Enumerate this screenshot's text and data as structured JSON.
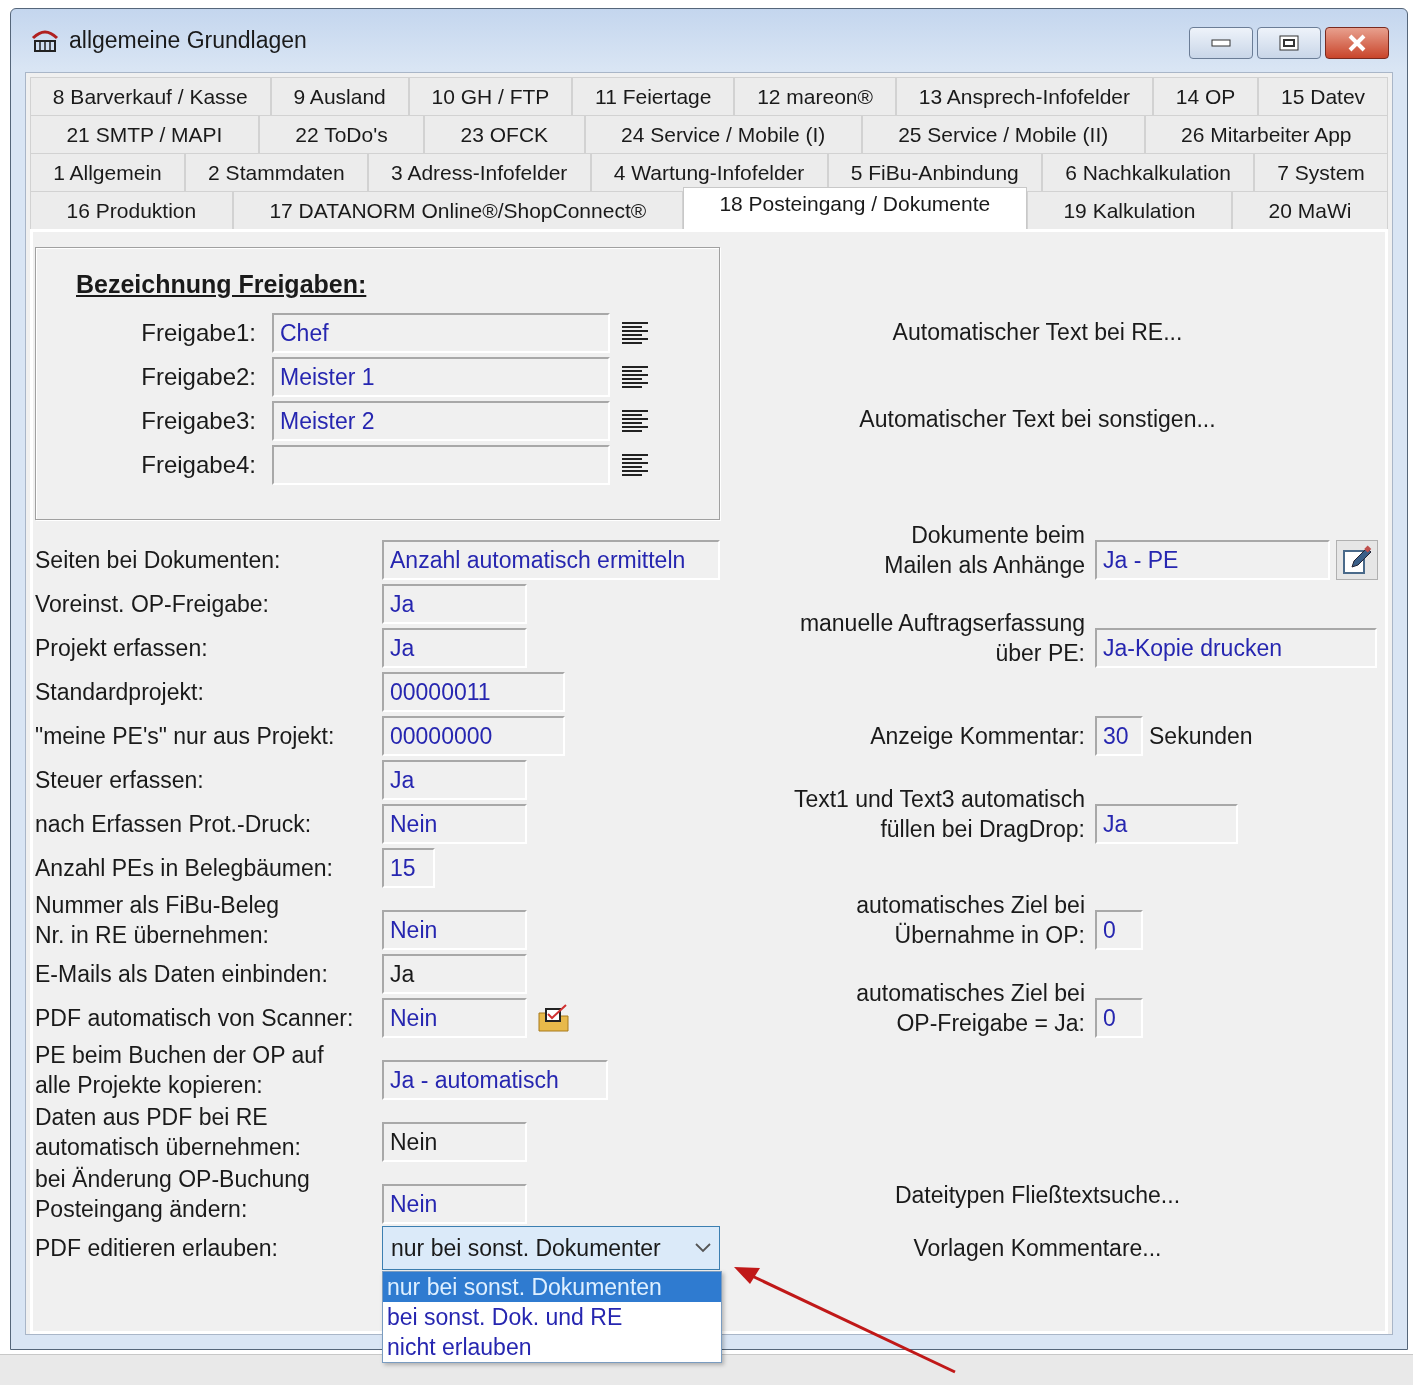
{
  "window": {
    "title": "allgemeine Grundlagen"
  },
  "tab_rows": [
    {
      "tabs": [
        {
          "label": "8 Barverkauf / Kasse",
          "selected": false
        },
        {
          "label": "9 Ausland",
          "selected": false
        },
        {
          "label": "10 GH / FTP",
          "selected": false
        },
        {
          "label": "11 Feiertage",
          "selected": false
        },
        {
          "label": "12 mareon®",
          "selected": false
        },
        {
          "label": "13 Ansprech-Infofelder",
          "selected": false
        },
        {
          "label": "14 OP",
          "selected": false
        },
        {
          "label": "15 Datev",
          "selected": false
        }
      ]
    },
    {
      "tabs": [
        {
          "label": "21 SMTP / MAPI",
          "selected": false
        },
        {
          "label": "22 ToDo's",
          "selected": false
        },
        {
          "label": "23 OFCK",
          "selected": false
        },
        {
          "label": "24 Service / Mobile (I)",
          "selected": false
        },
        {
          "label": "25 Service / Mobile (II)",
          "selected": false
        },
        {
          "label": "26 Mitarbeiter App",
          "selected": false
        }
      ]
    },
    {
      "tabs": [
        {
          "label": "1 Allgemein",
          "selected": false
        },
        {
          "label": "2 Stammdaten",
          "selected": false
        },
        {
          "label": "3 Adress-Infofelder",
          "selected": false
        },
        {
          "label": "4 Wartung-Infofelder",
          "selected": false
        },
        {
          "label": "5 FiBu-Anbindung",
          "selected": false
        },
        {
          "label": "6 Nachkalkulation",
          "selected": false
        },
        {
          "label": "7 System",
          "selected": false
        }
      ]
    },
    {
      "tabs": [
        {
          "label": "16 Produktion",
          "selected": false
        },
        {
          "label": "17 DATANORM Online®/ShopConnect®",
          "selected": false
        },
        {
          "label": "18 Posteingang / Dokumente",
          "selected": true
        },
        {
          "label": "19 Kalkulation",
          "selected": false
        },
        {
          "label": "20 MaWi",
          "selected": false
        }
      ]
    }
  ],
  "group": {
    "title": "Bezeichnung Freigaben:",
    "fields": [
      {
        "label": "Freigabe1:",
        "value": "Chef"
      },
      {
        "label": "Freigabe2:",
        "value": "Meister 1"
      },
      {
        "label": "Freigabe3:",
        "value": "Meister 2"
      },
      {
        "label": "Freigabe4:"
      }
    ]
  },
  "links": [
    "Automatischer Text bei RE...",
    "Automatischer Text bei sonstigen..."
  ],
  "rows": [
    {
      "kind": "field",
      "label": [
        "Seiten bei Dokumenten:"
      ],
      "value": "Anzahl automatisch ermitteln",
      "color": "#2626b0",
      "right": {
        "kind": "field-edit",
        "label": [
          "Dokumente beim",
          "Mailen als Anhänge"
        ],
        "value": "Ja - PE"
      }
    },
    {
      "kind": "field",
      "label": [
        "Voreinst. OP-Freigabe:"
      ],
      "value": "Ja",
      "color": "#2626b0"
    },
    {
      "kind": "field",
      "label": [
        "Projekt erfassen:"
      ],
      "value": "Ja",
      "color": "#2626b0",
      "right": {
        "kind": "field",
        "label": [
          "manuelle Auftragserfassung",
          "über PE:"
        ],
        "value": "Ja-Kopie drucken"
      }
    },
    {
      "kind": "field",
      "label": [
        "Standardprojekt:"
      ],
      "value": "00000011",
      "color": "#2626b0"
    },
    {
      "kind": "field",
      "label": [
        "\"meine PE's\" nur aus Projekt:"
      ],
      "value": "00000000",
      "color": "#2626b0",
      "right": {
        "kind": "field-unit",
        "label": [
          "Anzeige Kommentar:"
        ],
        "value": "30",
        "suffix": "Sekunden"
      }
    },
    {
      "kind": "field",
      "label": [
        "Steuer erfassen:"
      ],
      "value": "Ja",
      "color": "#2626b0"
    },
    {
      "kind": "field",
      "label": [
        "nach Erfassen Prot.-Druck:"
      ],
      "value": "Nein",
      "color": "#2626b0",
      "right": {
        "kind": "field",
        "label": [
          "Text1 und Text3 automatisch",
          "füllen bei DragDrop:"
        ],
        "value": "Ja"
      }
    },
    {
      "kind": "field",
      "label": [
        "Anzahl PEs in Belegbäumen:"
      ],
      "value": "15",
      "color": "#2626b0"
    },
    {
      "kind": "field",
      "label": [
        "Nummer als FiBu-Beleg",
        "Nr. in RE übernehmen:"
      ],
      "value": "Nein",
      "color": "#2626b0",
      "right": {
        "kind": "field",
        "label": [
          "automatisches Ziel bei",
          "Übernahme in OP:"
        ],
        "value": "0"
      }
    },
    {
      "kind": "field",
      "label": [
        "E-Mails als Daten einbinden:"
      ],
      "value": "Ja",
      "color": "#1a1a1a"
    },
    {
      "kind": "field-scan",
      "label": [
        "PDF automatisch von Scanner:"
      ],
      "value": "Nein",
      "color": "#2626b0",
      "right": {
        "kind": "field",
        "label": [
          "automatisches Ziel bei",
          "OP-Freigabe = Ja:"
        ],
        "value": "0"
      }
    },
    {
      "kind": "field",
      "label": [
        "PE beim Buchen der OP auf",
        "alle Projekte kopieren:"
      ],
      "value": "Ja - automatisch",
      "color": "#2626b0"
    },
    {
      "kind": "field",
      "label": [
        "Daten aus PDF bei RE",
        "automatisch übernehmen:"
      ],
      "value": "Nein",
      "color": "#1a1a1a"
    },
    {
      "kind": "field",
      "label": [
        "bei Änderung OP-Buchung",
        "Posteingang ändern:"
      ],
      "value": "Nein",
      "color": "#2626b0",
      "right": {
        "kind": "link",
        "label": [
          "Dateitypen Fließtextsuche..."
        ]
      }
    },
    {
      "kind": "dropdown",
      "label": [
        "PDF editieren erlauben:"
      ],
      "value": "nur bei sonst. Dokumenter",
      "color": "#1a1a1a",
      "expanded": true,
      "options": [
        {
          "label": "nur bei sonst. Dokumenten",
          "selected": true
        },
        {
          "label": "bei sonst. Dok. und RE",
          "selected": false
        },
        {
          "label": "nicht erlauben",
          "selected": false
        }
      ],
      "right": {
        "kind": "link",
        "label": [
          "Vorlagen Kommentare..."
        ]
      }
    }
  ]
}
